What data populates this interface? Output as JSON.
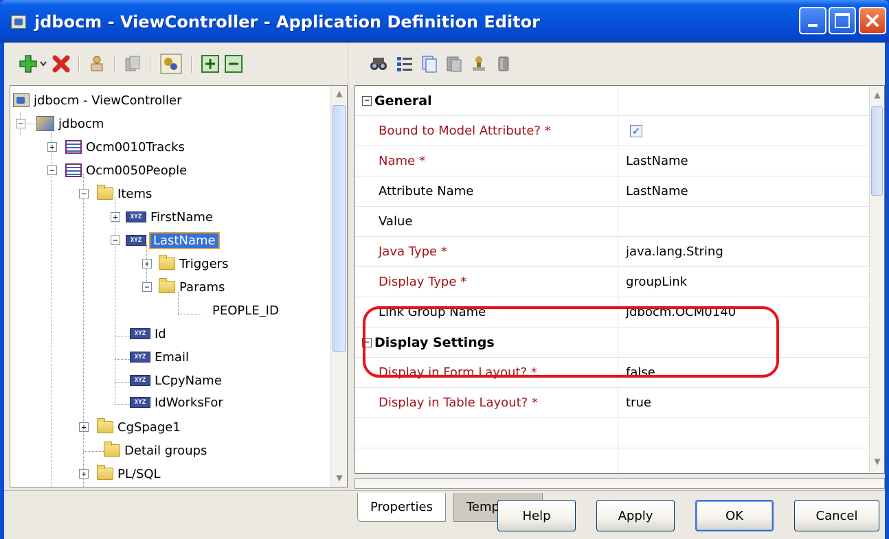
{
  "window": {
    "title": "jdbocm - ViewController - Application Definition Editor"
  },
  "tree": {
    "nodes": [
      {
        "label": "jdbocm - ViewController",
        "icon": "viewcontroller-icon"
      },
      {
        "label": "jdbocm",
        "icon": "application-icon"
      },
      {
        "label": "Ocm0010Tracks",
        "icon": "table-icon"
      },
      {
        "label": "Ocm0050People",
        "icon": "table-icon"
      },
      {
        "label": "Items",
        "icon": "folder-open-icon"
      },
      {
        "label": "FirstName",
        "icon": "item-icon"
      },
      {
        "label": "LastName",
        "icon": "item-icon"
      },
      {
        "label": "Triggers",
        "icon": "folder-icon"
      },
      {
        "label": "Params",
        "icon": "folder-open-icon"
      },
      {
        "label": "PEOPLE_ID",
        "icon": ""
      },
      {
        "label": "Id",
        "icon": "item-icon"
      },
      {
        "label": "Email",
        "icon": "item-icon"
      },
      {
        "label": "LCpyName",
        "icon": "item-icon"
      },
      {
        "label": "IdWorksFor",
        "icon": "item-icon"
      },
      {
        "label": "CgSpage1",
        "icon": "folder-icon"
      },
      {
        "label": "Detail groups",
        "icon": "folder-icon"
      },
      {
        "label": "PL/SQL",
        "icon": "folder-icon"
      }
    ],
    "item_icon_text": "XYZ",
    "selected": "LastName"
  },
  "properties": {
    "sections": [
      {
        "title": "General",
        "rows": [
          {
            "name": "Bound to Model Attribute? *",
            "value": "",
            "checked": true,
            "required": true
          },
          {
            "name": "Name *",
            "value": "LastName",
            "required": true
          },
          {
            "name": "Attribute Name",
            "value": "LastName",
            "required": false
          },
          {
            "name": "Value",
            "value": "",
            "required": false
          },
          {
            "name": "Java Type *",
            "value": "java.lang.String",
            "required": true
          },
          {
            "name": "Display Type *",
            "value": "groupLink",
            "required": true
          },
          {
            "name": "Link Group Name",
            "value": "jdbocm.OCM0140",
            "required": false
          }
        ]
      },
      {
        "title": "Display Settings",
        "rows": [
          {
            "name": "Display in Form Layout? *",
            "value": "false",
            "required": true
          },
          {
            "name": "Display in Table Layout? *",
            "value": "true",
            "required": true
          }
        ]
      }
    ]
  },
  "tabs": {
    "properties": "Properties",
    "templates": "Templates"
  },
  "buttons": {
    "help": "Help",
    "apply": "Apply",
    "ok": "OK",
    "cancel": "Cancel"
  },
  "colors": {
    "title_bar": "#0552dc",
    "required_text": "#a31515",
    "highlight_oval": "#e8121c",
    "selection": "#3571d7"
  }
}
